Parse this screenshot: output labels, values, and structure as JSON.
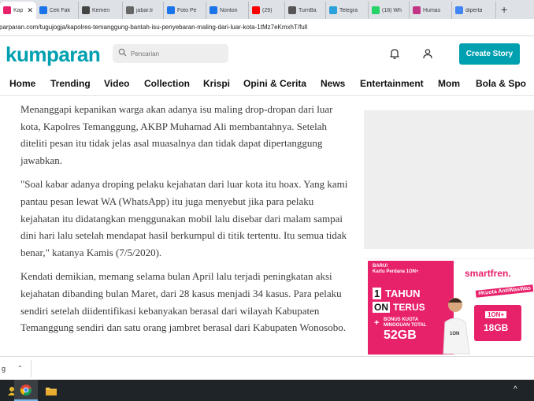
{
  "browser": {
    "tabs": [
      {
        "label": "Kap",
        "icon": "kumparan-icon",
        "color": "#e8216b",
        "active": true
      },
      {
        "label": "Cek Fak",
        "icon": "site-icon",
        "color": "#1a73e8"
      },
      {
        "label": "Kemen",
        "icon": "globe-icon",
        "color": "#444444"
      },
      {
        "label": "jabar.tr",
        "icon": "globe-icon",
        "color": "#666666"
      },
      {
        "label": "Foto Pe",
        "icon": "site-icon",
        "color": "#1a73e8"
      },
      {
        "label": "Nonton",
        "icon": "play-icon",
        "color": "#1a73e8"
      },
      {
        "label": "(29)",
        "icon": "youtube-icon",
        "color": "#ff0000"
      },
      {
        "label": "TurnBa",
        "icon": "settings-icon",
        "color": "#555555"
      },
      {
        "label": "Telegra",
        "icon": "telegram-icon",
        "color": "#2aa1da"
      },
      {
        "label": "(18) Wh",
        "icon": "whatsapp-icon",
        "color": "#25d366"
      },
      {
        "label": "Humas",
        "icon": "instagram-icon",
        "color": "#c13584"
      },
      {
        "label": "diperta",
        "icon": "google-icon",
        "color": "#4285f4"
      }
    ],
    "new_tab": "+",
    "close_glyph": "✕",
    "url": "parparan.com/tugujogja/kapolres-temanggung-bantah-isu-penyebaran-maling-dari-luar-kota-1tMz7eKmxhT/full"
  },
  "site": {
    "logo": "kumparan",
    "logo_color": "#00a0b0",
    "search_placeholder": "Pencarian",
    "create_story": "Create Story"
  },
  "nav": {
    "items": [
      "Home",
      "Trending",
      "Video",
      "Collection",
      "Krispi",
      "Opini & Cerita",
      "News",
      "Entertainment",
      "Mom",
      "Bola & Spo"
    ]
  },
  "article": {
    "paragraphs": [
      "Menanggapi kepanikan warga akan adanya isu maling drop-dropan dari luar kota, Kapolres Temanggung, AKBP Muhamad Ali membantahnya. Setelah diteliti pesan itu tidak jelas asal muasalnya dan tidak dapat dipertanggung jawabkan.",
      "\"Soal kabar adanya droping pelaku kejahatan dari luar kota itu hoax. Yang kami pantau pesan lewat WA (WhatsApp) itu juga menyebut jika para pelaku kejahatan itu didatangkan menggunakan mobil lalu disebar dari malam sampai dini hari lalu setelah mendapat hasil berkumpul di titik tertentu. Itu semua tidak benar,\" katanya Kamis (7/5/2020).",
      "Kendati demikian, memang selama bulan April lalu terjadi peningkatan aksi kejahatan dibanding bulan Maret, dari 28 kasus menjadi 34 kasus. Para pelaku sendiri setelah diidentifikasi kebanyakan berasal dari wilayah Kabupaten Temanggung sendiri dan satu orang jambret berasal dari Kabupaten Wonosobo."
    ]
  },
  "ad": {
    "promo_line1": "BARU!",
    "promo_line2": "Kartu Perdana 1ON+",
    "year_number": "1",
    "year_word": "TAHUN",
    "on_word": "ON",
    "terus_word": "TERUS",
    "plus": "+",
    "bonus_line1": "BONUS KUOTA",
    "bonus_line2": "MINGGUAN TOTAL",
    "bonus_amount": "52GB",
    "brand": "smartfren.",
    "tag": "#Kuota AntiWasWas",
    "card_label": "1ON+",
    "card_amount": "18GB",
    "pink": "#e8216b"
  },
  "download_bar": {
    "item_label": "g"
  },
  "taskbar": {
    "items": [
      {
        "icon": "app-icon"
      },
      {
        "icon": "chrome-icon",
        "active": true
      },
      {
        "icon": "file-explorer-icon"
      }
    ],
    "tray_glyph": "^"
  }
}
